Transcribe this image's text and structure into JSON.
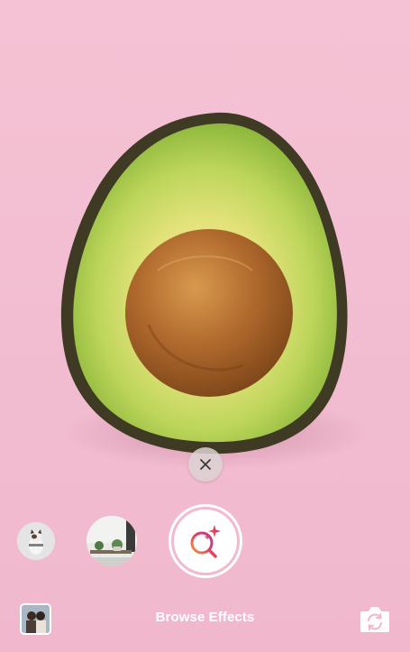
{
  "camera": {
    "subject_icon": "avocado-half-image"
  },
  "controls": {
    "close_icon": "close-icon",
    "capture_icon": "search-sparkle-icon",
    "flip_icon": "camera-flip-icon"
  },
  "effects": [
    {
      "name": "cat-effect-thumbnail"
    },
    {
      "name": "room-effect-thumbnail"
    }
  ],
  "bottom_bar": {
    "browse_label": "Browse Effects"
  },
  "colors": {
    "background": "#f3bcd0",
    "accent_gradient_start": "#f59a3c",
    "accent_gradient_end": "#c4308f",
    "ring": "#ffffff"
  }
}
